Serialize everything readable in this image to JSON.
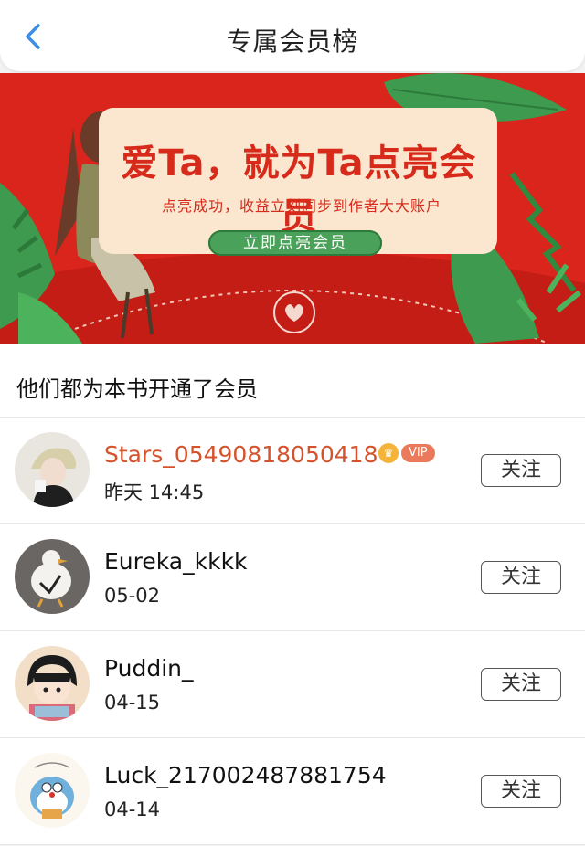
{
  "nav": {
    "title": "专属会员榜",
    "back_icon": "chevron-left-icon",
    "accent": "#3a8ee6"
  },
  "banner": {
    "title": "爱Ta，就为Ta点亮会员",
    "subtitle": "点亮成功，收益立刻同步到作者大大账户",
    "button_label": "立即点亮会员",
    "colors": {
      "background": "#d9251c",
      "card": "#fbe7cf",
      "button": "#4aa159"
    }
  },
  "section": {
    "title": "他们都为本书开通了会员"
  },
  "members": [
    {
      "name": "Stars_05490818050418",
      "time": "昨天 14:45",
      "vip": true,
      "vip_label": "VIP",
      "follow_label": "关注",
      "avatar": "avatar-woman-with-hat"
    },
    {
      "name": "Eureka_kkkk",
      "time": "05-02",
      "vip": false,
      "follow_label": "关注",
      "avatar": "avatar-duck"
    },
    {
      "name": "Puddin_",
      "time": "04-15",
      "vip": false,
      "follow_label": "关注",
      "avatar": "avatar-cartoon-girl"
    },
    {
      "name": "Luck_217002487881754",
      "time": "04-14",
      "vip": false,
      "follow_label": "关注",
      "avatar": "avatar-doraemon-lucky"
    }
  ]
}
